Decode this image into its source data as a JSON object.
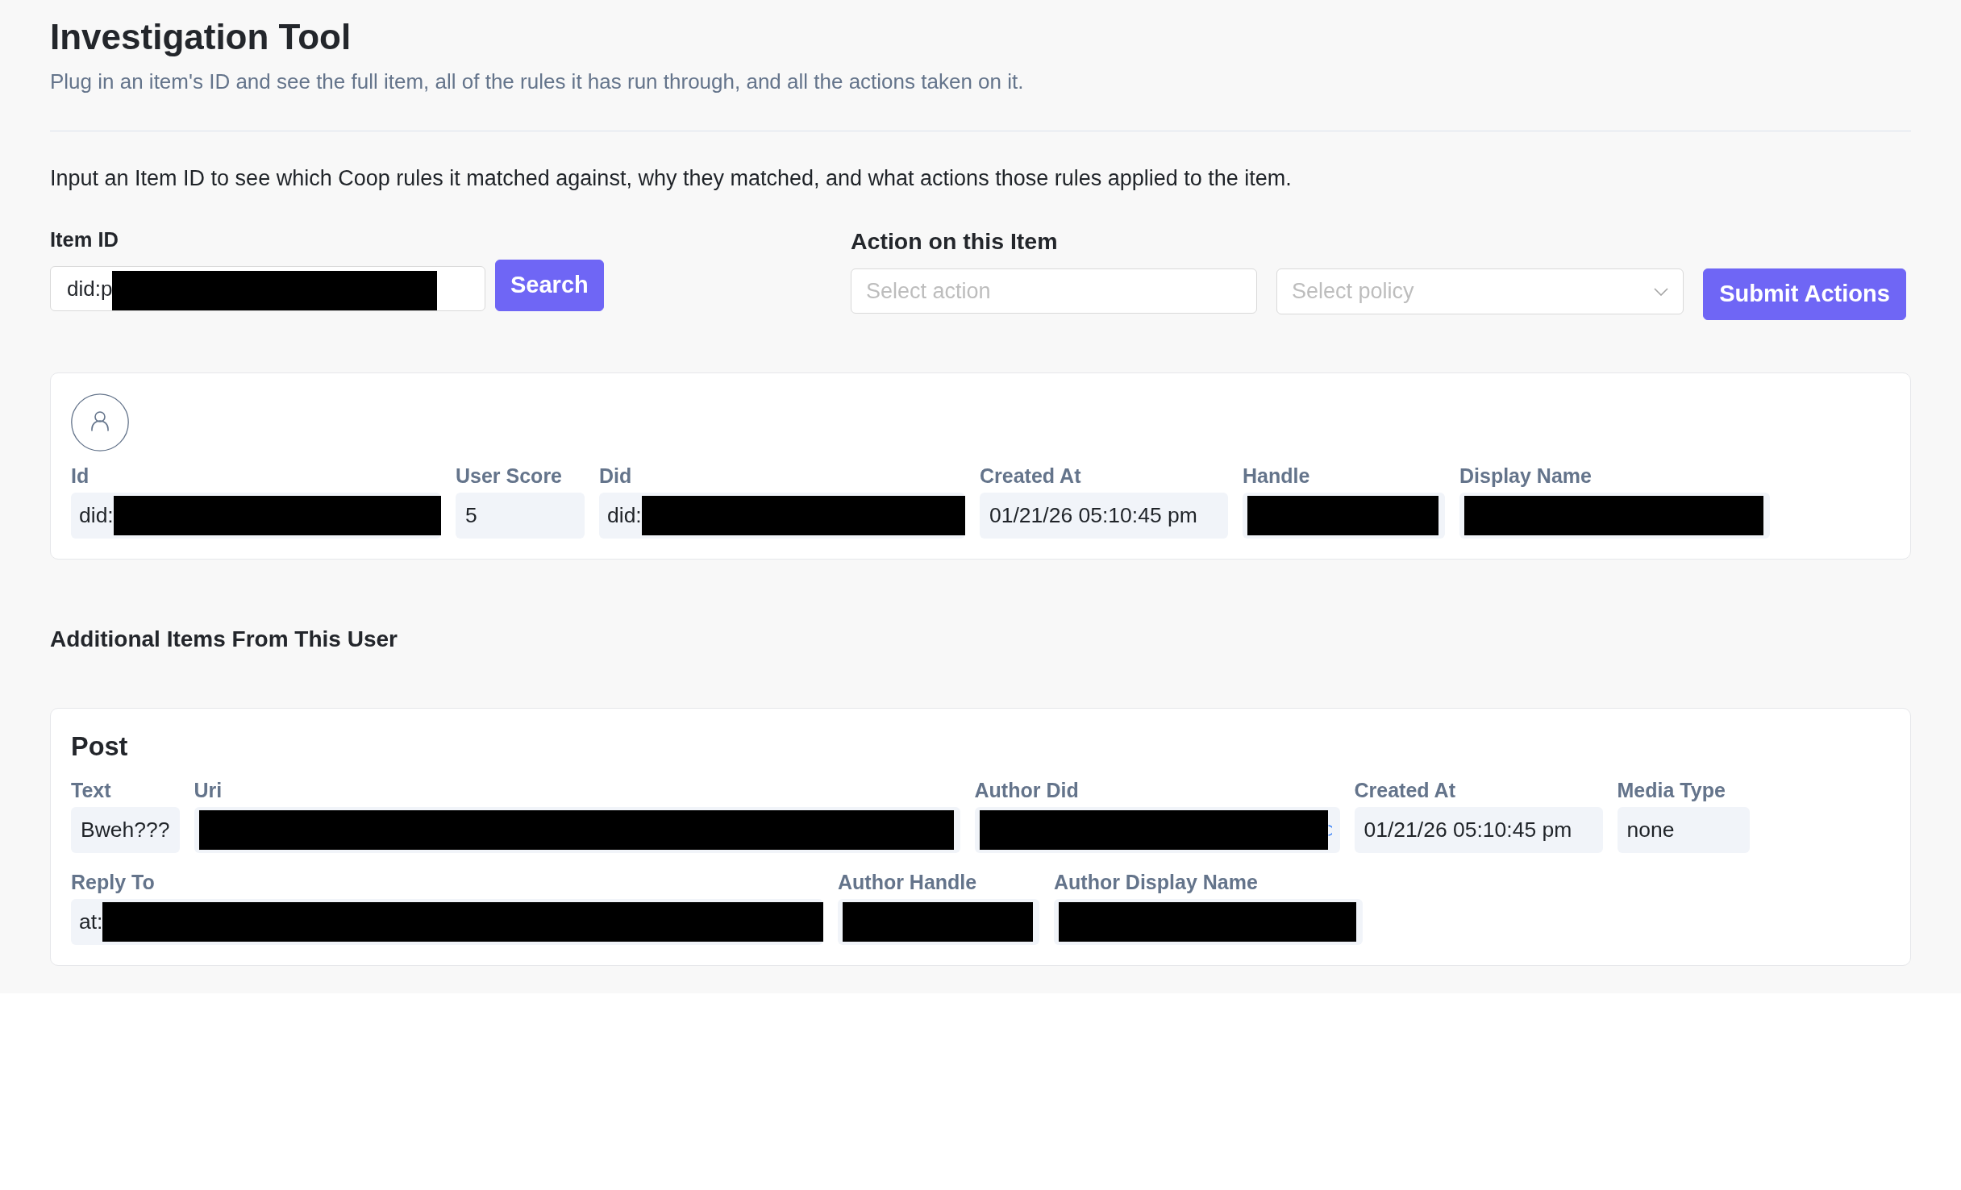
{
  "header": {
    "title": "Investigation Tool",
    "subtitle": "Plug in an item's ID and see the full item, all of the rules it has run through, and all the actions taken on it."
  },
  "instructions": "Input an Item ID to see which Coop rules it matched against, why they matched, and what actions those rules applied to the item.",
  "item_search": {
    "label": "Item ID",
    "field": {
      "value": "did:p",
      "redacted": true
    },
    "button": "Search"
  },
  "item_actions": {
    "title": "Action on this Item",
    "action_field": {
      "placeholder": "Select action"
    },
    "policy_select": {
      "placeholder": "Select policy"
    },
    "button": "Submit Actions"
  },
  "user_card": {
    "fields": [
      {
        "label": "Id",
        "value": "did:",
        "redacted": true
      },
      {
        "label": "User Score",
        "value": "5",
        "redacted": false
      },
      {
        "label": "Did",
        "value": "did:",
        "redacted": true
      },
      {
        "label": "Created At",
        "value": "01/21/26 05:10:45 pm",
        "redacted": false
      },
      {
        "label": "Handle",
        "redacted": true
      },
      {
        "label": "Display Name",
        "redacted": true
      }
    ]
  },
  "additional_items": {
    "title": "Additional Items From This User",
    "items": [
      {
        "title": "Post",
        "rows": [
          [
            {
              "label": "Text",
              "value": "Bweh???",
              "redacted": false
            },
            {
              "label": "Uri",
              "redacted": true
            },
            {
              "label": "Author Did",
              "redacted": true,
              "trailing_icon": true
            },
            {
              "label": "Created At",
              "value": "01/21/26 05:10:45 pm",
              "redacted": false
            },
            {
              "label": "Media Type",
              "value": "none",
              "redacted": false
            }
          ],
          [
            {
              "label": "Reply To",
              "value": "at:",
              "redacted": true
            },
            {
              "label": "Author Handle",
              "redacted": true
            },
            {
              "label": "Author Display Name",
              "redacted": true
            }
          ]
        ]
      }
    ]
  }
}
